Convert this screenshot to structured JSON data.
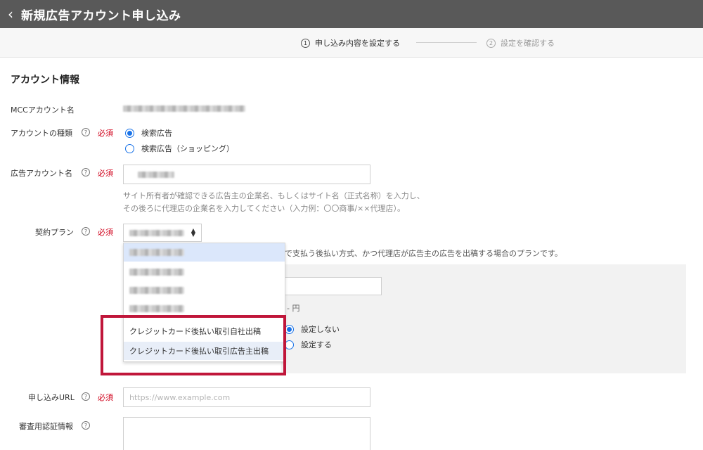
{
  "header": {
    "back_icon": "chevron-left-icon",
    "title": "新規広告アカウント申し込み"
  },
  "stepper": {
    "step1": {
      "num": "1",
      "label": "申し込み内容を設定する"
    },
    "step2": {
      "num": "2",
      "label": "設定を確認する"
    }
  },
  "section": {
    "heading": "アカウント情報"
  },
  "fields": {
    "mcc": {
      "label": "MCCアカウント名"
    },
    "account_type": {
      "label": "アカウントの種類",
      "required": "必須",
      "options": [
        "検索広告",
        "検索広告（ショッピング）"
      ],
      "selected": "検索広告"
    },
    "account_name": {
      "label": "広告アカウント名",
      "required": "必須",
      "help_line1": "サイト所有者が確認できる広告主の企業名、もしくはサイト名（正式名称）を入力し、",
      "help_line2": "その後ろに代理店の企業名を入力してください（入力例：〇〇商事/××代理店）。"
    },
    "plan": {
      "label": "契約プラン",
      "required": "必須",
      "description": "で支払う後払い方式、かつ代理店が広告主の広告を出稿する場合のプランです。",
      "options": [
        "クレジットカード後払い取引自社出稿",
        "クレジットカード後払い取引広告主出稿"
      ],
      "panel_unit": "- 円",
      "panel_radio": [
        "設定しない",
        "設定する"
      ],
      "panel_radio_selected": "設定しない"
    },
    "url": {
      "label": "申し込みURL",
      "required": "必須",
      "placeholder": "https://www.example.com"
    },
    "review": {
      "label": "審査用認証情報"
    }
  },
  "colors": {
    "accent": "#1a73e8",
    "required": "#d0021b",
    "highlight_border": "#c0163a",
    "header_bg": "#595959"
  }
}
